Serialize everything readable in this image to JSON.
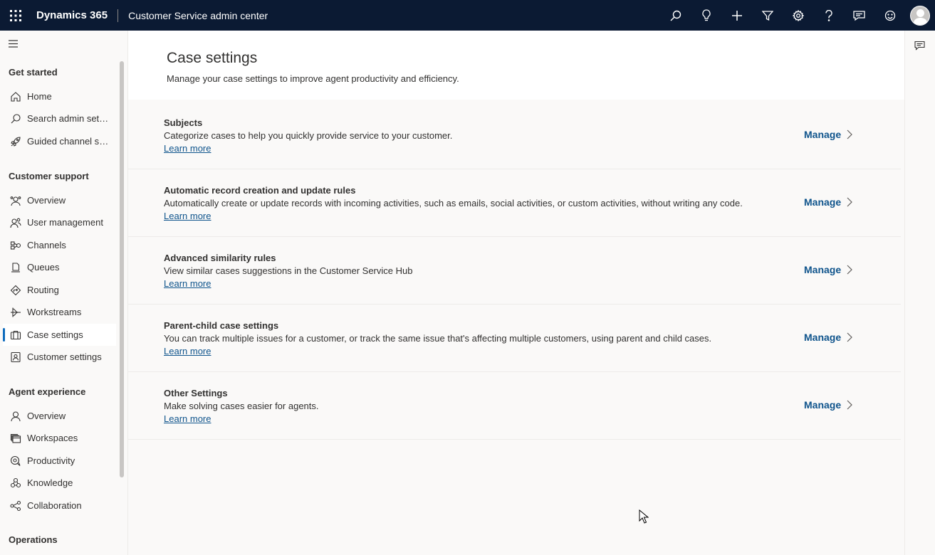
{
  "topbar": {
    "brand": "Dynamics 365",
    "app_name": "Customer Service admin center",
    "icons": [
      "search-icon",
      "lightbulb-icon",
      "plus-icon",
      "filter-icon",
      "gear-icon",
      "help-icon",
      "chat-icon",
      "smiley-icon",
      "avatar"
    ]
  },
  "sidebar": {
    "groups": [
      {
        "title": "Get started",
        "items": [
          {
            "label": "Home",
            "icon": "home-icon"
          },
          {
            "label": "Search admin setti...",
            "icon": "search-icon"
          },
          {
            "label": "Guided channel se...",
            "icon": "rocket-icon"
          }
        ]
      },
      {
        "title": "Customer support",
        "items": [
          {
            "label": "Overview",
            "icon": "overview-icon"
          },
          {
            "label": "User management",
            "icon": "users-icon"
          },
          {
            "label": "Channels",
            "icon": "channels-icon"
          },
          {
            "label": "Queues",
            "icon": "queue-icon"
          },
          {
            "label": "Routing",
            "icon": "routing-icon"
          },
          {
            "label": "Workstreams",
            "icon": "workstreams-icon"
          },
          {
            "label": "Case settings",
            "icon": "case-icon",
            "selected": true
          },
          {
            "label": "Customer settings",
            "icon": "customer-icon"
          }
        ]
      },
      {
        "title": "Agent experience",
        "items": [
          {
            "label": "Overview",
            "icon": "person-icon"
          },
          {
            "label": "Workspaces",
            "icon": "workspaces-icon"
          },
          {
            "label": "Productivity",
            "icon": "productivity-icon"
          },
          {
            "label": "Knowledge",
            "icon": "knowledge-icon"
          },
          {
            "label": "Collaboration",
            "icon": "collaboration-icon"
          }
        ]
      },
      {
        "title": "Operations",
        "items": []
      }
    ]
  },
  "page": {
    "title": "Case settings",
    "subtitle": "Manage your case settings to improve agent productivity and efficiency."
  },
  "settings": [
    {
      "title": "Subjects",
      "description": "Categorize cases to help you quickly provide service to your customer.",
      "link": "Learn more",
      "action": "Manage"
    },
    {
      "title": "Automatic record creation and update rules",
      "description": "Automatically create or update records with incoming activities, such as emails, social activities, or custom activities, without writing any code.",
      "link": "Learn more",
      "action": "Manage"
    },
    {
      "title": "Advanced similarity rules",
      "description": "View similar cases suggestions in the Customer Service Hub",
      "link": "Learn more",
      "action": "Manage"
    },
    {
      "title": "Parent-child case settings",
      "description": "You can track multiple issues for a customer, or track the same issue that's affecting multiple customers, using parent and child cases.",
      "link": "Learn more",
      "action": "Manage"
    },
    {
      "title": "Other Settings",
      "description": "Make solving cases easier for agents.",
      "link": "Learn more",
      "action": "Manage"
    }
  ],
  "colors": {
    "topbar": "#0b1a33",
    "accent": "#0f6cbd",
    "link": "#0f548c"
  }
}
